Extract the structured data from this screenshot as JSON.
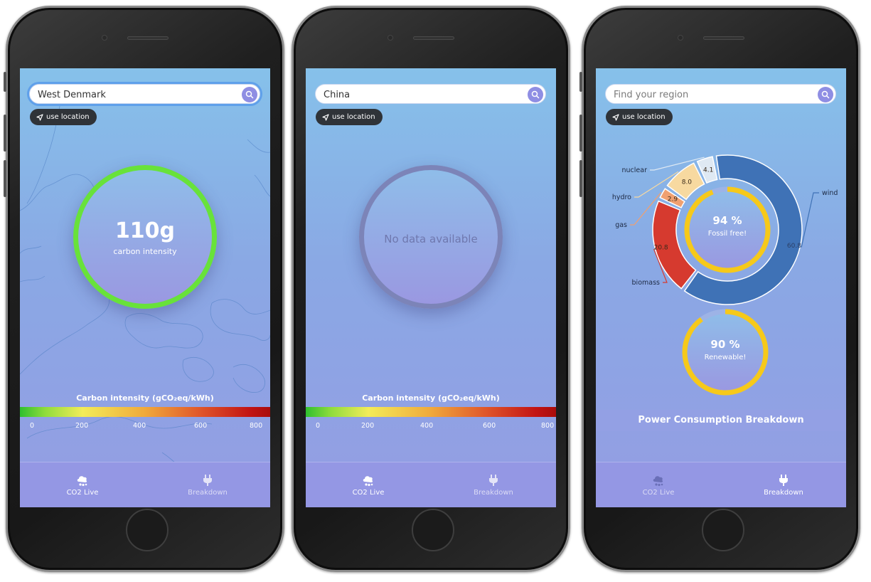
{
  "common": {
    "use_location_label": "use location",
    "legend_title": "Carbon intensity (gCO₂eq/kWh)",
    "legend_ticks": [
      "0",
      "200",
      "400",
      "600",
      "800"
    ],
    "tabs": [
      {
        "label": "CO2 Live",
        "icon": "cloud-icon"
      },
      {
        "label": "Breakdown",
        "icon": "plug-icon"
      }
    ],
    "colors": {
      "ring_green": "#68e23a",
      "ring_grey": "#7c84b8",
      "accent": "#8f8ee3",
      "tabbar": "#9497e4"
    }
  },
  "phone1": {
    "search_value": "West Denmark",
    "search_placeholder": "",
    "carbon_value": "110g",
    "carbon_label": "carbon intensity",
    "active_tab": "CO2 Live"
  },
  "phone2": {
    "search_value": "China",
    "search_placeholder": "",
    "no_data_text": "No data available",
    "active_tab": "CO2 Live"
  },
  "phone3": {
    "search_value": "",
    "search_placeholder": "Find your region",
    "fossil_free_percent": "94 %",
    "fossil_free_label": "Fossil free!",
    "renewable_percent": "90 %",
    "renewable_label": "Renewable!",
    "breakdown_title": "Power Consumption Breakdown",
    "active_tab": "Breakdown",
    "chart_data": {
      "type": "pie",
      "series": [
        {
          "name": "wind",
          "value": 60.8,
          "color": "#3f72b6"
        },
        {
          "name": "biomass",
          "value": 20.8,
          "color": "#d63a2f"
        },
        {
          "name": "gas",
          "value": 2.9,
          "color": "#f0a070"
        },
        {
          "name": "hydro",
          "value": 8.0,
          "color": "#f7d9a0"
        },
        {
          "name": "nuclear",
          "value": 4.1,
          "color": "#dfe9f3"
        }
      ],
      "labels": {
        "wind": "60.8",
        "biomass": "20.8",
        "gas": "2.9",
        "hydro": "8.0",
        "nuclear": "4.1"
      },
      "fossil_free_fraction": 0.94,
      "renewable_fraction": 0.9
    }
  }
}
